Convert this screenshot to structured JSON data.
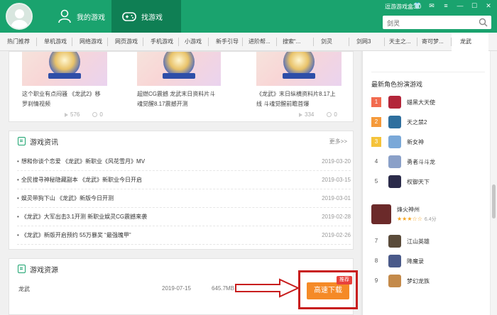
{
  "header": {
    "tabs": [
      {
        "label": "我的游戏",
        "icon": "person-icon"
      },
      {
        "label": "找游戏",
        "icon": "gamepad-icon"
      }
    ],
    "app_title": "逗游游戏盒3.0",
    "window_buttons": [
      "shirt-icon",
      "mail-icon",
      "menu-icon",
      "minimize-icon",
      "maximize-icon",
      "close-icon"
    ],
    "search_value": "剑灵"
  },
  "categories": [
    "热门推荐",
    "单机游戏",
    "网络游戏",
    "网页游戏",
    "手机游戏",
    "小游戏",
    "新手引导",
    "进阶帮...",
    "搜索“...",
    "剑灵",
    "剑网3",
    "天主之...",
    "寄可梦...",
    "龙武"
  ],
  "article_cards": [
    {
      "title_lines": [
        "这个职业有点闷骚 《龙武2》移",
        "罗刹情视频"
      ],
      "views": "576",
      "likes": "0"
    },
    {
      "title_lines": [
        "超燃CG震撼 龙武末日资料片斗",
        "魂觉醒8.17震撼开测"
      ],
      "views": "",
      "likes": ""
    },
    {
      "title_lines": [
        "《龙武》末日纵横资料片8.17上",
        "线 斗魂觉醒前瞻首爆"
      ],
      "views": "334",
      "likes": "0"
    }
  ],
  "news": {
    "title": "游戏资讯",
    "more": "更多>>",
    "items": [
      {
        "title": "想和你谈个恋爱 《龙武》新职业《风花雪月》MV",
        "date": "2019-03-20"
      },
      {
        "title": "全民搜寻神秘隐藏副本 《龙武》新职业今日开启",
        "date": "2019-03-15"
      },
      {
        "title": "娱灵带狗下山 《龙武》新版今日开测",
        "date": "2019-03-01"
      },
      {
        "title": "《龙武》大军出击3.1开测 新职业娱灵CG震撼来袭",
        "date": "2019-02-28"
      },
      {
        "title": "《龙武》新版开启预约 55万暴奖 “最强魄甲”",
        "date": "2019-02-26"
      }
    ]
  },
  "resources": {
    "title": "游戏资源",
    "name": "龙武",
    "date": "2019-07-15",
    "size": "645.7MB",
    "download_label": "高速下载",
    "tag": "推荐"
  },
  "sidebar": {
    "title": "最新角色扮演游戏",
    "ranks": [
      {
        "num": "1",
        "name": "蜡黑大天使",
        "num_color": "#f26b4f",
        "icon_color": "#b3263a"
      },
      {
        "num": "2",
        "name": "天之禁2",
        "num_color": "#f59a3b",
        "icon_color": "#2f6f9e"
      },
      {
        "num": "3",
        "name": "新女神",
        "num_color": "#f5c33b",
        "icon_color": "#7aa8d8"
      },
      {
        "num": "4",
        "name": "勇者斗斗龙",
        "num_color": "#ffffff",
        "icon_color": "#8aa0c8"
      },
      {
        "num": "5",
        "name": "权御天下",
        "num_color": "#ffffff",
        "icon_color": "#2b2b4a"
      }
    ],
    "featured": {
      "name": "烽火神州",
      "stars": "★★★☆☆",
      "score": "6.4分",
      "icon_color": "#6b2a2a"
    },
    "ranks2": [
      {
        "num": "7",
        "name": "江山英雄",
        "num_color": "#ffffff",
        "icon_color": "#5a4b3a"
      },
      {
        "num": "8",
        "name": "降魔录",
        "num_color": "#ffffff",
        "icon_color": "#4a5a8a"
      },
      {
        "num": "9",
        "name": "梦幻龙族",
        "num_color": "#ffffff",
        "icon_color": "#c48a4a"
      }
    ]
  }
}
